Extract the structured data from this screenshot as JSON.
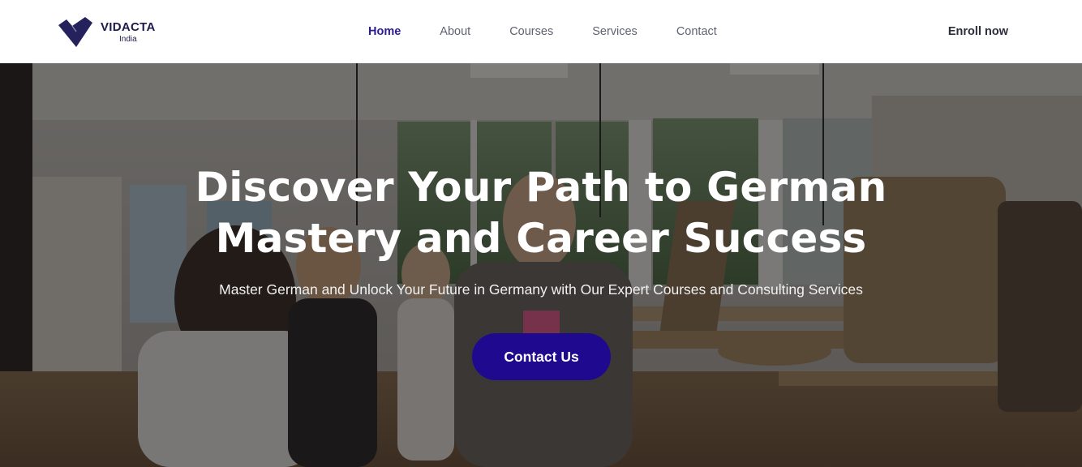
{
  "brand": {
    "name": "VIDACTA",
    "sub": "India",
    "color": "#1e1b4b"
  },
  "nav": {
    "items": [
      {
        "label": "Home",
        "active": true
      },
      {
        "label": "About",
        "active": false
      },
      {
        "label": "Courses",
        "active": false
      },
      {
        "label": "Services",
        "active": false
      },
      {
        "label": "Contact",
        "active": false
      }
    ],
    "active_color": "#2a1a9c",
    "color": "#5f6272"
  },
  "header": {
    "cta_label": "Enroll now"
  },
  "hero": {
    "title": "Discover Your Path to German Mastery and Career Success",
    "subtitle": "Master German and Unlock Your Future in Germany with Our Expert Courses and Consulting Services",
    "button_label": "Contact Us",
    "button_color": "#1f0a8f",
    "background": "classroom-photo"
  }
}
